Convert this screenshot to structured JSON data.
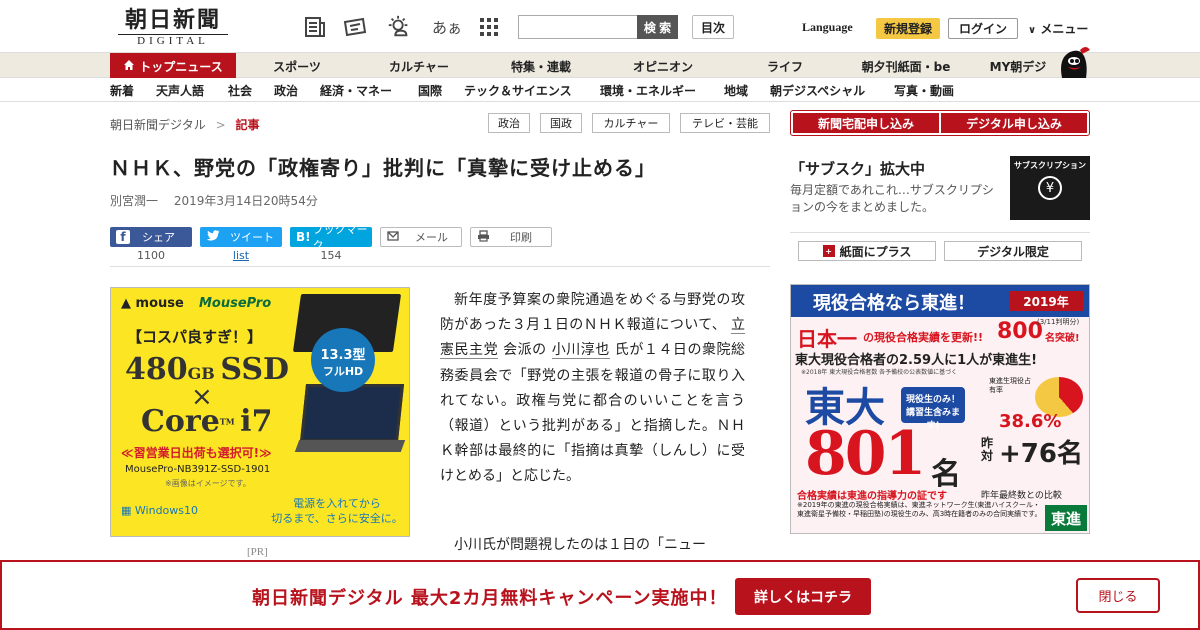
{
  "header": {
    "logo_ja": "朝日新聞",
    "logo_en": "DIGITAL",
    "font_size_label": "あぁ",
    "search_placeholder": "",
    "search_label": "検 索",
    "toc_label": "目次",
    "language_label": "Language",
    "register_label": "新規登録",
    "login_label": "ログイン",
    "menu_label": "メニュー"
  },
  "nav": {
    "top_label": "トップニュース",
    "items": [
      "スポーツ",
      "カルチャー",
      "特集・連載",
      "オピニオン",
      "ライフ",
      "朝夕刊紙面・be",
      "MY朝デジ"
    ]
  },
  "subnav": {
    "items": [
      "新着",
      "天声人語",
      "社会",
      "政治",
      "経済・マネー",
      "国際",
      "テック＆サイエンス",
      "環境・エネルギー",
      "地域",
      "朝デジスペシャル",
      "写真・動画"
    ]
  },
  "breadcrumb": {
    "home": "朝日新聞デジタル",
    "separator": ">",
    "current": "記事"
  },
  "tags": [
    "政治",
    "国政",
    "カルチャー",
    "テレビ・芸能"
  ],
  "article": {
    "headline": "ＮＨＫ、野党の「政権寄り」批判に「真摯に受け止める」",
    "author": "別宮潤一",
    "date": "2019年3月14日20時54分",
    "para1_a": "新年度予算案の衆院通過をめぐる与野党の攻防があった３月１日のＮＨＫ報道について、",
    "party_link": "立憲民主党",
    "para1_b": "会派の",
    "person_link": "小川淳也",
    "para1_c": "氏が１４日の衆院総務委員会で「野党の主張を報道の骨子に取り入れてない。政権与党に都合のいいことを言う（報道）という批判がある」と指摘した。ＮＨＫ幹部は最終的に「指摘は真摯（しんし）に受けとめる」と応じた。",
    "para2": "小川氏が問題視したのは１日の「ニュー"
  },
  "share": {
    "facebook_label": "シェア",
    "facebook_count": "1100",
    "twitter_label": "ツイート",
    "twitter_count": "list",
    "hatena_label": "ブックマーク",
    "hatena_logo": "B!",
    "hatena_count": "154",
    "mail_label": "メール",
    "print_label": "印刷"
  },
  "ad_left": {
    "brand": "mouse",
    "brand2": "MousePro",
    "catch": "【コスパ良すぎ！】",
    "ssd_num": "480",
    "ssd_unit": "GB",
    "ssd_label": "SSD",
    "cross": "×",
    "cpu": "Core",
    "cpu_tm": "TM",
    "cpu_model": "i7",
    "shipping": "≪習営業日出荷も選択可!≫",
    "model": "MousePro-NB391Z-SSD-1901",
    "note": "※画像はイメージです。",
    "screen_size": "13.3型",
    "screen_label": "フルHD",
    "power_line1": "電源を入れてから",
    "power_line2": "切るまで、さらに安全に。",
    "os": "Windows10",
    "pr_label": "[PR]"
  },
  "right": {
    "btn1": "新聞宅配申し込み",
    "btn2": "デジタル申し込み",
    "promo_title": "「サブスク」拡大中",
    "promo_text": "毎月定額であれこれ…サブスクリプションの今をまとめました。",
    "promo_img_label": "サブスクリプション",
    "box1": "紙面にプラス",
    "box2": "デジタル限定"
  },
  "ad_right": {
    "headline": "現役合格なら東進！",
    "year": "2019年",
    "nihon": "日本一",
    "record": "の現役合格実績を更新!!",
    "count": "800",
    "count_suffix": "名突破!",
    "date_note": "(3/11判明分)",
    "ratio_text": "東大現役合格者の2.59人に1人が東進生!",
    "small_note": "※2018年 東大現役合格者数 各予備校の公表数値に基づく",
    "todai": "東大",
    "number": "801",
    "mei": "名",
    "badge1": "現役生のみ！",
    "badge2": "講習生含みます!",
    "share_label": "東進生現役占有率",
    "percent": "38.6%",
    "last_year": "昨対",
    "diff": "+76名",
    "proof": "合格実績は東進の指導力の証です",
    "compare": "昨年最終数との比較",
    "foot": "※2019年の東進の現役合格実績は、東進ネットワーク生(東進ハイスクール・東進衛星予備校・早稲田塾)の現役生のみ、高3時在籍者のみの合同実績です。",
    "logo": "東進"
  },
  "banner": {
    "text": "朝日新聞デジタル 最大2カ月無料キャンペーン実施中！",
    "button": "詳しくはコチラ",
    "close": "閉じる"
  },
  "colors": {
    "brand_red": "#b8121c",
    "facebook": "#3b5998",
    "twitter": "#1da1f2",
    "hatena": "#00a4de",
    "register_yellow": "#f5c843"
  }
}
